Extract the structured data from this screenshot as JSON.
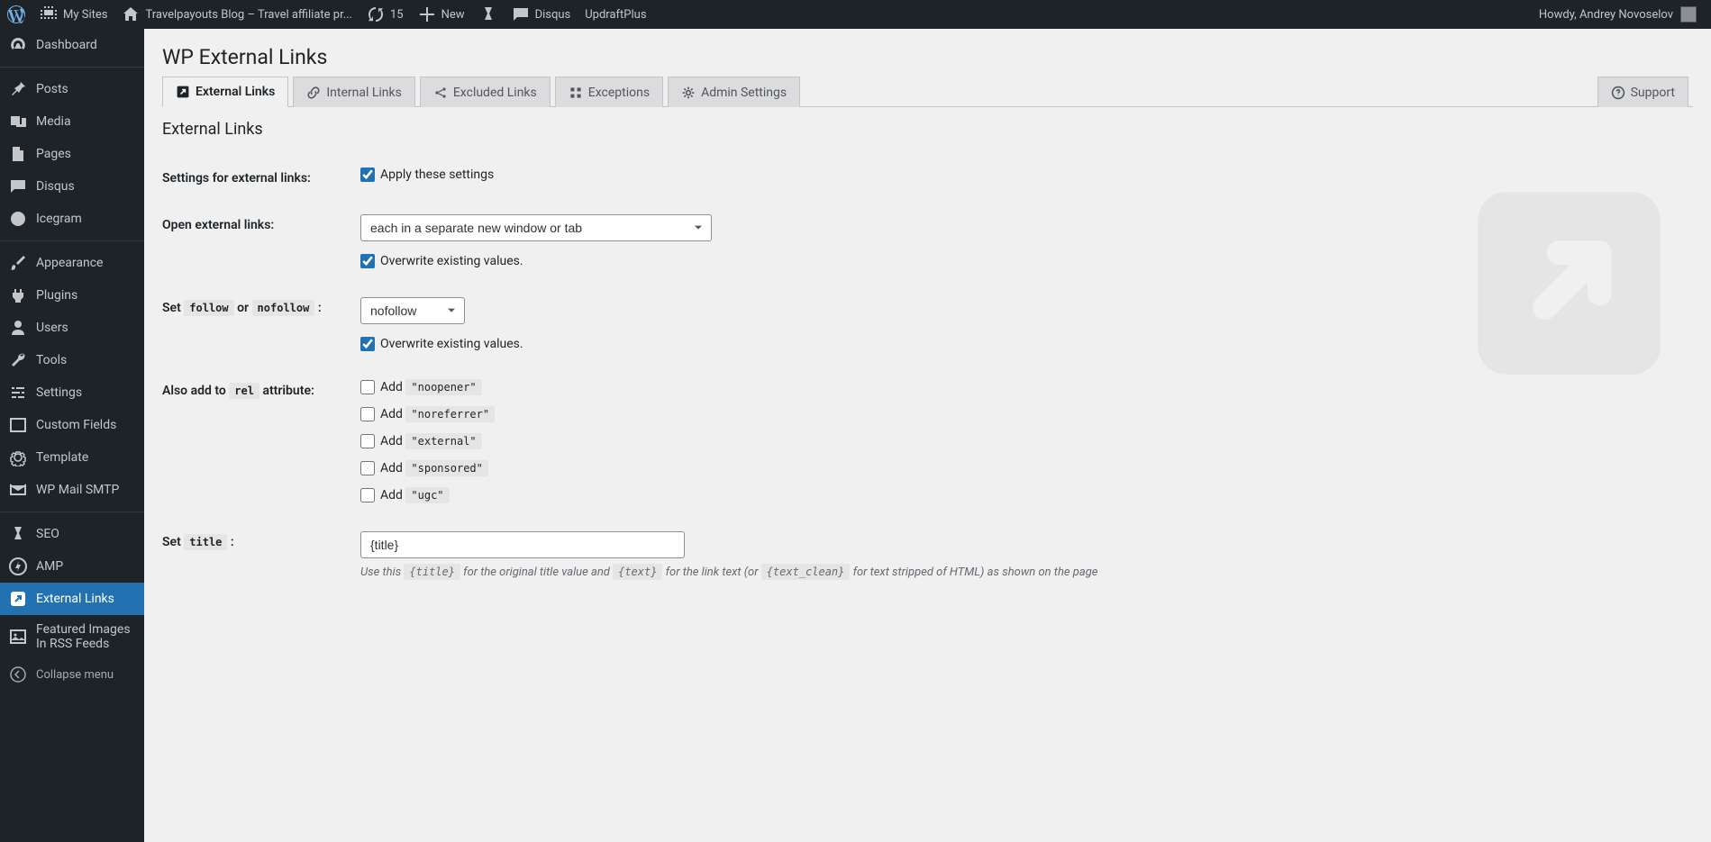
{
  "adminbar": {
    "my_sites": "My Sites",
    "site_title": "Travelpayouts Blog – Travel affiliate pr...",
    "updates_count": "15",
    "new": "New",
    "disqus": "Disqus",
    "updraft": "UpdraftPlus",
    "greeting": "Howdy, Andrey Novoselov"
  },
  "sidebar": {
    "dashboard": "Dashboard",
    "posts": "Posts",
    "media": "Media",
    "pages": "Pages",
    "disqus": "Disqus",
    "icegram": "Icegram",
    "appearance": "Appearance",
    "plugins": "Plugins",
    "users": "Users",
    "tools": "Tools",
    "settings": "Settings",
    "custom_fields": "Custom Fields",
    "template": "Template",
    "wp_mail_smtp": "WP Mail SMTP",
    "seo": "SEO",
    "amp": "AMP",
    "external_links": "External Links",
    "featured_images": "Featured Images In RSS Feeds",
    "collapse": "Collapse menu"
  },
  "page": {
    "title": "WP External Links",
    "section_title": "External Links"
  },
  "tabs": {
    "external": "External Links",
    "internal": "Internal Links",
    "excluded": "Excluded Links",
    "exceptions": "Exceptions",
    "admin": "Admin Settings",
    "support": "Support"
  },
  "form": {
    "settings_label": "Settings for external links:",
    "apply_label": "Apply these settings",
    "open_label": "Open external links:",
    "open_value": "each in a separate new window or tab",
    "overwrite1": "Overwrite existing values.",
    "set_follow_prefix": "Set ",
    "follow_code": "follow",
    "or_word": " or ",
    "nofollow_code": "nofollow",
    "colon": " :",
    "follow_value": "nofollow",
    "overwrite2": "Overwrite existing values.",
    "also_add_prefix": "Also add to ",
    "rel_code": "rel",
    "attribute_suffix": " attribute:",
    "add_word": "Add ",
    "noopener": "\"noopener\"",
    "noreferrer": "\"noreferrer\"",
    "external": "\"external\"",
    "sponsored": "\"sponsored\"",
    "ugc": "\"ugc\"",
    "set_title_prefix": "Set ",
    "title_code": "title",
    "title_value": "{title}",
    "desc_1": "Use this ",
    "desc_code1": "{title}",
    "desc_2": " for the original title value and ",
    "desc_code2": "{text}",
    "desc_3": " for the link text (or ",
    "desc_code3": "{text_clean}",
    "desc_4": " for text stripped of HTML) as shown on the page"
  }
}
